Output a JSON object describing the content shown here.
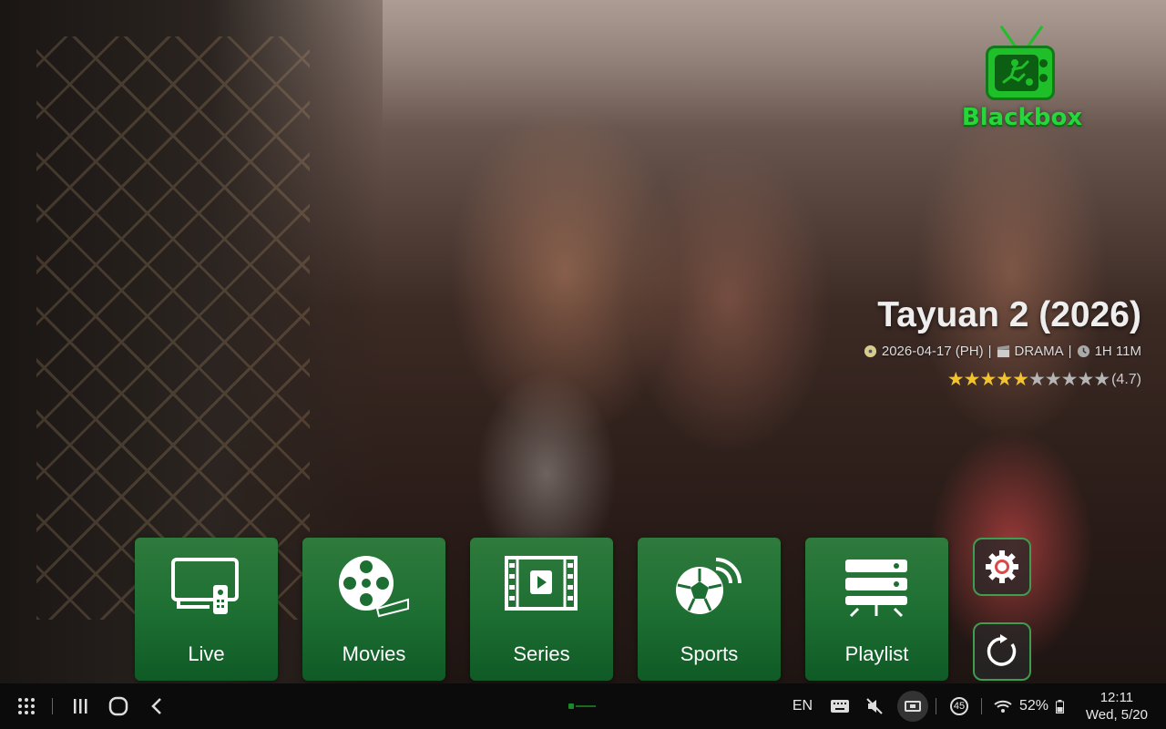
{
  "app": {
    "brand": "Blackbox",
    "accent_color": "#1fbf2a",
    "tile_color": "#1d6e32"
  },
  "featured": {
    "title": "Tayuan 2 (2026)",
    "release": "2026-04-17 (PH)",
    "genre": "DRAMA",
    "duration": "1H 11M",
    "separator": "|",
    "rating_stars_full": 5,
    "rating_stars_total": 10,
    "rating_value": "(4.7)",
    "release_icon": "disc-icon",
    "genre_icon": "clapperboard-icon",
    "duration_icon": "clock-icon"
  },
  "menu": {
    "items": [
      {
        "label": "Live",
        "icon": "tv-remote-icon"
      },
      {
        "label": "Movies",
        "icon": "film-reel-icon"
      },
      {
        "label": "Series",
        "icon": "film-strip-play-icon"
      },
      {
        "label": "Sports",
        "icon": "soccer-ball-signal-icon"
      },
      {
        "label": "Playlist",
        "icon": "server-list-icon"
      }
    ],
    "side_buttons": [
      {
        "name": "settings",
        "icon": "gear-icon"
      },
      {
        "name": "refresh",
        "icon": "refresh-icon"
      }
    ]
  },
  "system_bar": {
    "language": "EN",
    "notification_count": "45",
    "battery": "52%",
    "time": "12:11",
    "date": "Wed, 5/20"
  }
}
